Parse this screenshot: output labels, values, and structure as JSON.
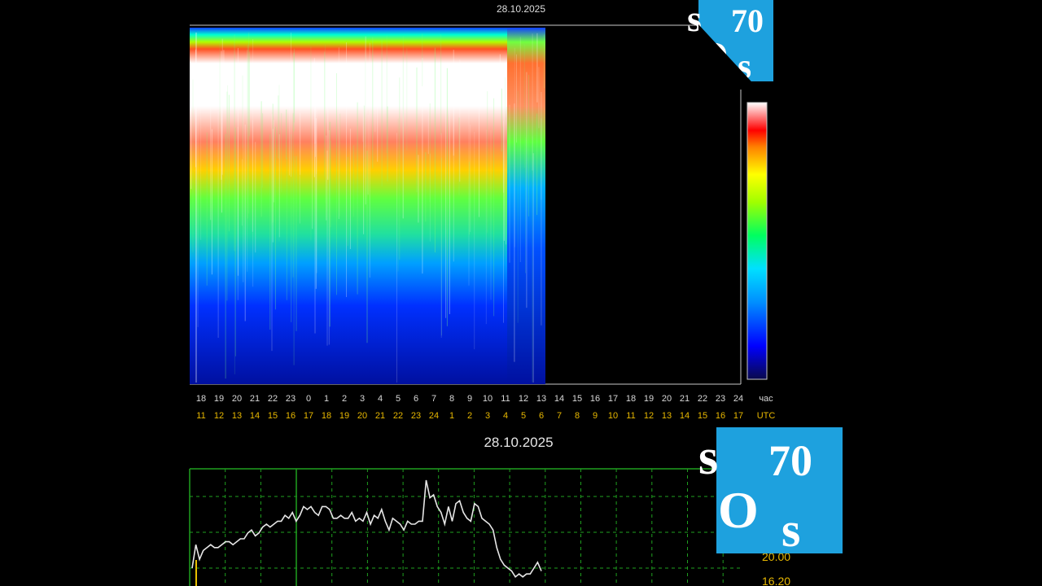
{
  "spectrogram": {
    "date": "28.10.2025",
    "local_hour_ticks": [
      "18",
      "19",
      "20",
      "21",
      "22",
      "23",
      "0",
      "1",
      "2",
      "3",
      "4",
      "5",
      "6",
      "7",
      "8",
      "9",
      "10",
      "11",
      "12",
      "13",
      "14",
      "15",
      "16",
      "17",
      "18",
      "19",
      "20",
      "21",
      "22",
      "23",
      "24"
    ],
    "local_unit": "час",
    "utc_hour_ticks": [
      "11",
      "12",
      "13",
      "14",
      "15",
      "16",
      "17",
      "18",
      "19",
      "20",
      "21",
      "22",
      "23",
      "24",
      "1",
      "2",
      "3",
      "4",
      "5",
      "6",
      "7",
      "8",
      "9",
      "10",
      "11",
      "12",
      "13",
      "14",
      "15",
      "16",
      "17"
    ],
    "utc_unit": "UTC",
    "data_covered_until_tick_index": 19,
    "colorbar_colors": [
      "#0a0a4a",
      "#0000ff",
      "#0090ff",
      "#00e0ff",
      "#00ff60",
      "#a0ff00",
      "#ffff00",
      "#ff8000",
      "#ff0000",
      "#ffffff"
    ],
    "logo": {
      "letters": [
        "s",
        "70",
        "O",
        "s"
      ]
    }
  },
  "chart_data": {
    "type": "line",
    "title": "28.10.2025",
    "y_tick_labels_visible": [
      "20.00",
      "16.20"
    ],
    "series": [
      {
        "values": [
          5,
          13,
          8,
          11,
          12,
          13,
          12,
          12,
          13,
          14,
          14,
          13,
          14,
          15,
          15,
          17,
          18,
          16,
          17,
          19,
          20,
          19,
          20,
          21,
          21,
          23,
          22,
          24,
          21,
          23,
          26,
          25,
          26,
          24,
          23,
          26,
          26,
          25,
          22,
          22,
          23,
          22,
          22,
          24,
          21,
          22,
          21,
          24,
          20,
          23,
          22,
          25,
          21,
          18,
          22,
          21,
          20,
          18,
          21,
          20,
          20,
          21,
          21,
          35,
          29,
          30,
          26,
          24,
          20,
          26,
          21,
          27,
          28,
          24,
          22,
          21,
          27,
          26,
          22,
          21,
          20,
          18,
          12,
          8,
          6,
          5,
          4,
          2,
          3,
          2,
          3,
          3,
          5,
          7,
          4
        ],
        "color": "#e6e6e6"
      }
    ],
    "ylim": [
      0,
      40
    ]
  },
  "logo_bottom": {
    "letters": [
      "s",
      "70",
      "O",
      "s"
    ]
  }
}
